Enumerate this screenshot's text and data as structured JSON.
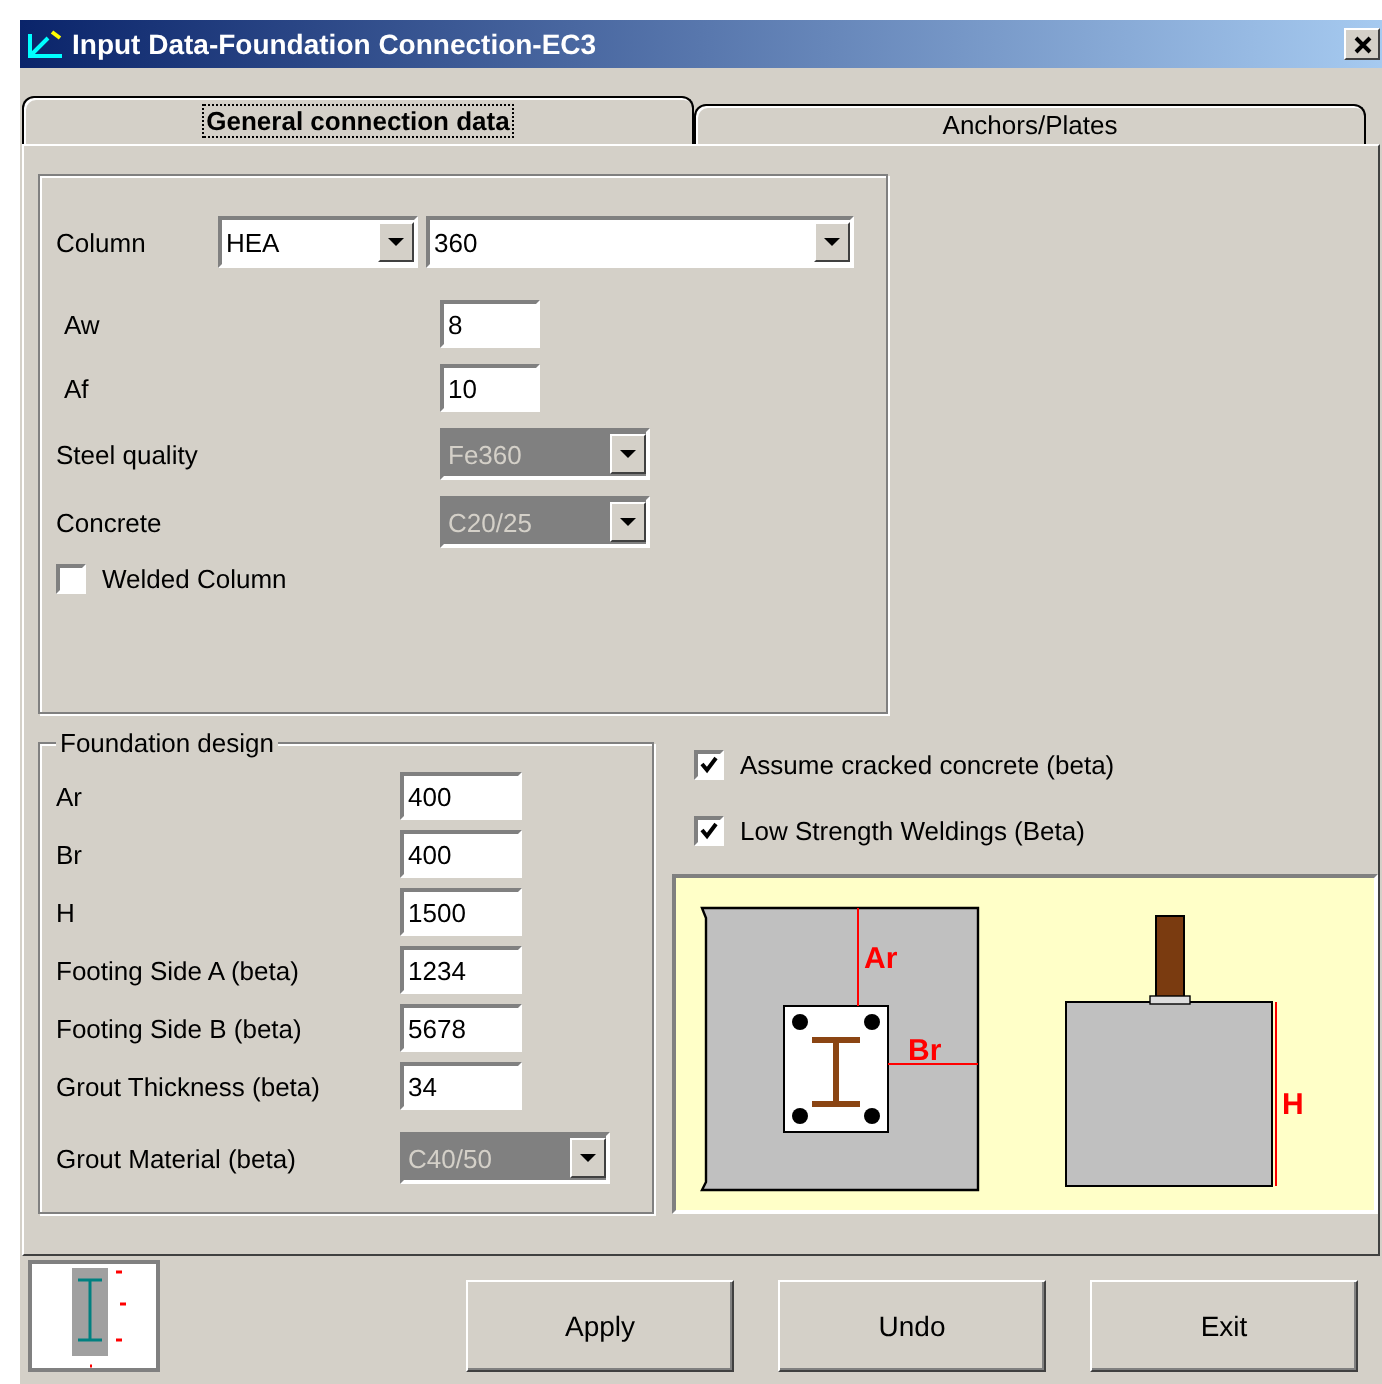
{
  "window": {
    "title": "Input Data-Foundation Connection-EC3"
  },
  "tabs": [
    {
      "label": "General connection data",
      "selected": true
    },
    {
      "label": "Anchors/Plates",
      "selected": false
    }
  ],
  "general": {
    "column": {
      "label": "Column",
      "type": {
        "value": "HEA",
        "disabled": false
      },
      "size": {
        "value": "360",
        "disabled": false
      }
    },
    "fields": [
      {
        "kind": "input",
        "label": "Aw",
        "value": "8"
      },
      {
        "kind": "input",
        "label": "Af",
        "value": "10"
      },
      {
        "kind": "dropdown",
        "label": "Steel quality",
        "value": "Fe360",
        "disabled": true
      },
      {
        "kind": "dropdown",
        "label": "Concrete",
        "value": "C20/25",
        "disabled": true
      }
    ],
    "welded_column": {
      "label": "Welded Column",
      "checked": false
    }
  },
  "foundation": {
    "title": "Foundation design",
    "fields": [
      {
        "kind": "input",
        "label": "Ar",
        "value": "400"
      },
      {
        "kind": "input",
        "label": "Br",
        "value": "400"
      },
      {
        "kind": "input",
        "label": "H",
        "value": "1500"
      },
      {
        "kind": "input",
        "label": "Footing Side A (beta)",
        "value": "1234"
      },
      {
        "kind": "input",
        "label": "Footing Side B (beta)",
        "value": "5678"
      },
      {
        "kind": "input",
        "label": "Grout Thickness (beta)",
        "value": "34"
      },
      {
        "kind": "dropdown",
        "label": "Grout Material (beta)",
        "value": "C40/50",
        "disabled": true
      }
    ]
  },
  "options": [
    {
      "label": "Assume cracked concrete (beta)",
      "checked": true
    },
    {
      "label": "Low Strength Weldings (Beta)",
      "checked": true
    }
  ],
  "diagram": {
    "labels": [
      "Ar",
      "Br",
      "H"
    ]
  },
  "buttons": [
    "Apply",
    "Undo",
    "Exit"
  ]
}
